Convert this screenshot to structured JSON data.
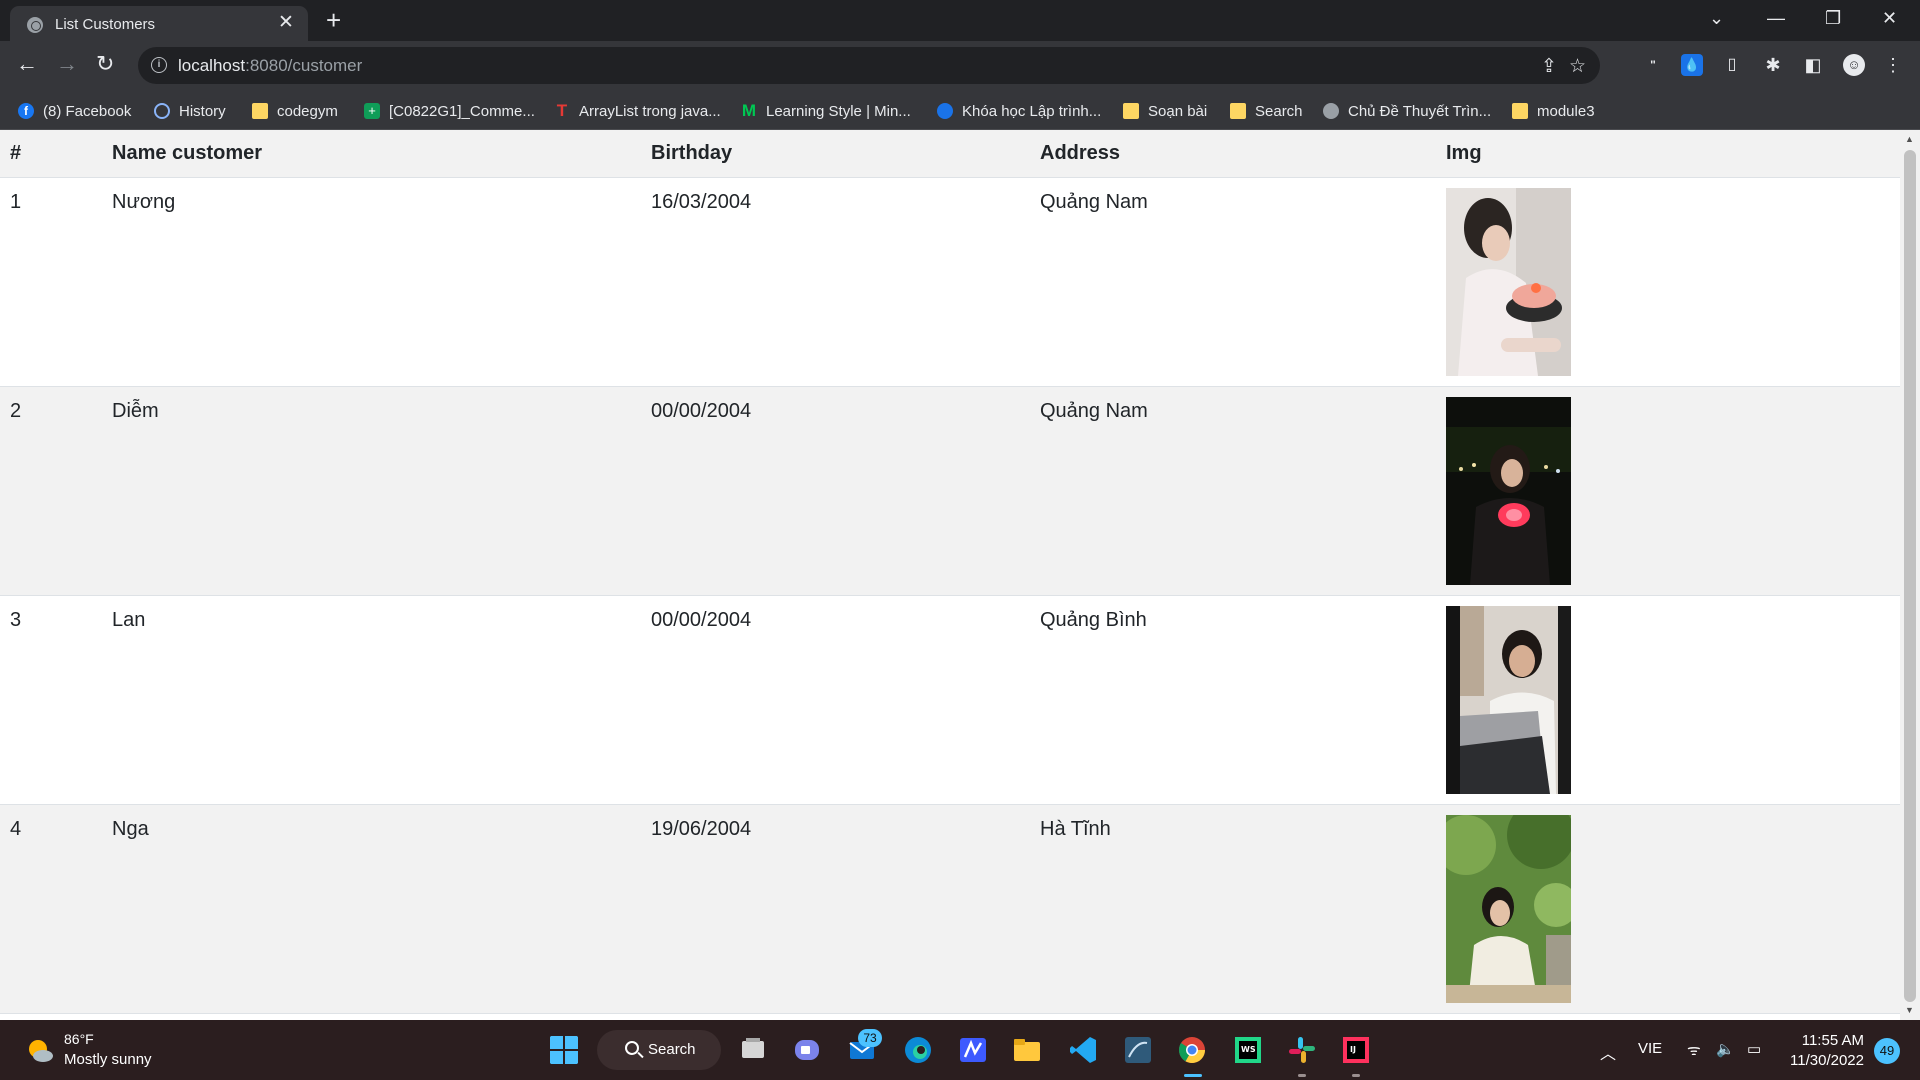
{
  "browser": {
    "tab_title": "List Customers",
    "url_host": "localhost",
    "url_path": ":8080/customer"
  },
  "bookmarks": [
    {
      "label": "(8) Facebook",
      "icon": "facebook-icon",
      "color": "#1877f2"
    },
    {
      "label": "History",
      "icon": "history-icon",
      "color": "#8ab4f8"
    },
    {
      "label": "codegym",
      "icon": "folder-icon",
      "color": "#fdd663"
    },
    {
      "label": "[C0822G1]_Comme...",
      "icon": "sheets-icon",
      "color": "#0f9d58"
    },
    {
      "label": "ArrayList trong java...",
      "icon": "t-icon",
      "color": "#e53935"
    },
    {
      "label": "Learning Style | Min...",
      "icon": "m-icon",
      "color": "#00c853"
    },
    {
      "label": "Khóa học Lập trình...",
      "icon": "globe-icon",
      "color": "#1a73e8"
    },
    {
      "label": "Soạn bài",
      "icon": "folder-icon",
      "color": "#fdd663"
    },
    {
      "label": "Search",
      "icon": "folder-icon",
      "color": "#fdd663"
    },
    {
      "label": "Chủ Đề Thuyết Trìn...",
      "icon": "globe-icon",
      "color": "#9aa0a6"
    },
    {
      "label": "module3",
      "icon": "folder-icon",
      "color": "#fdd663"
    }
  ],
  "table": {
    "headers": [
      "#",
      "Name customer",
      "Birthday",
      "Address",
      "Img"
    ],
    "rows": [
      {
        "id": "1",
        "name": "Nương",
        "birthday": "16/03/2004",
        "address": "Quảng Nam",
        "img": "photo-woman-with-cake"
      },
      {
        "id": "2",
        "name": "Diễm",
        "birthday": "00/00/2004",
        "address": "Quảng Nam",
        "img": "photo-woman-night-lantern"
      },
      {
        "id": "3",
        "name": "Lan",
        "birthday": "00/00/2004",
        "address": "Quảng Bình",
        "img": "photo-woman-laptop"
      },
      {
        "id": "4",
        "name": "Nga",
        "birthday": "19/06/2004",
        "address": "Hà Tĩnh",
        "img": "photo-woman-trees"
      }
    ]
  },
  "taskbar": {
    "weather_temp": "86°F",
    "weather_desc": "Mostly sunny",
    "search_label": "Search",
    "mail_badge": "73",
    "language": "VIE",
    "time": "11:55 AM",
    "date": "11/30/2022",
    "notifications": "49"
  }
}
